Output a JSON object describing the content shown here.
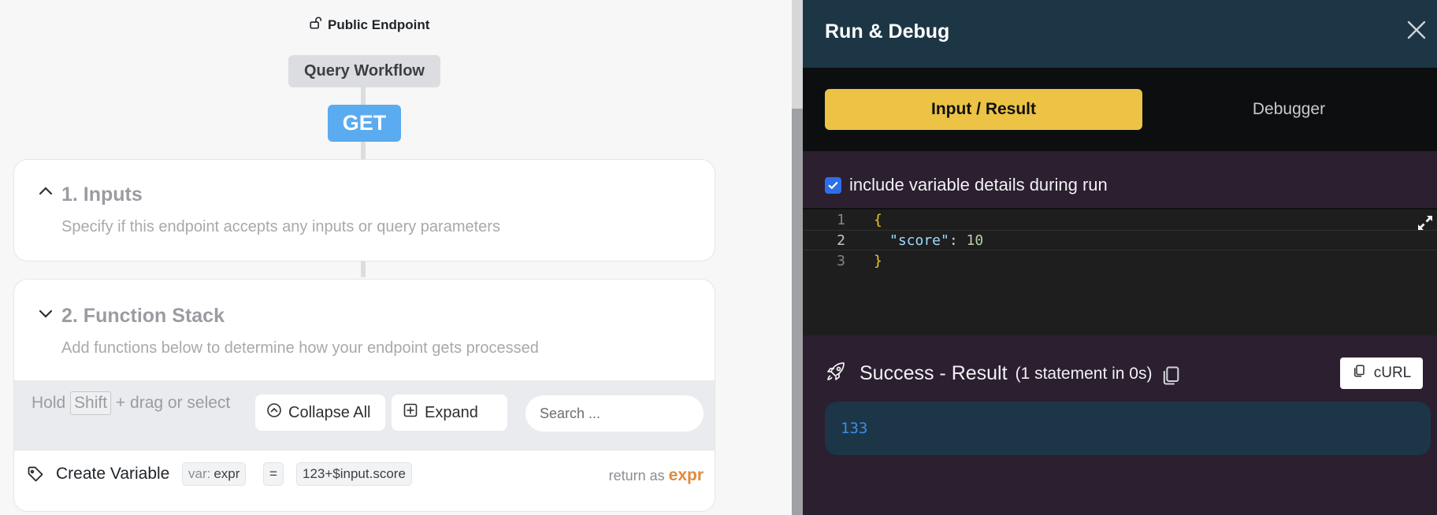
{
  "canvas": {
    "endpoint_label": "Public Endpoint",
    "workflow_name": "Query Workflow",
    "method": "GET",
    "inputs": {
      "title": "1. Inputs",
      "subtitle": "Specify if this endpoint accepts any inputs or query parameters"
    },
    "function_stack": {
      "title": "2. Function Stack",
      "subtitle": "Add functions below to determine how your endpoint gets processed",
      "hint_prefix": "Hold",
      "hint_key": "Shift",
      "hint_suffix": "+ drag or select",
      "collapse_label": "Collapse All",
      "expand_label": "Expand",
      "search_placeholder": "Search ...",
      "row": {
        "name": "Create Variable",
        "var_prefix": "var:",
        "var_name": "expr",
        "operator": "=",
        "expression": "123+$input.score",
        "return_prefix": "return as",
        "return_name": "expr"
      }
    }
  },
  "panel": {
    "title": "Run & Debug",
    "tabs": [
      "Input / Result",
      "Debugger"
    ],
    "include_details_label": "include variable details during run",
    "include_details_checked": true,
    "editor": {
      "lines": [
        "1",
        "2",
        "3"
      ],
      "open_brace": "{",
      "key": "\"score\"",
      "colon": ":",
      "value": "10",
      "close_brace": "}"
    },
    "result": {
      "title": "Success - Result",
      "meta": "(1 statement in 0s)",
      "curl_label": "cURL",
      "value": "133"
    }
  },
  "colors": {
    "accent_yellow": "#ecc344",
    "get_blue": "#5aabf0",
    "panel_header": "#1d3646",
    "return_orange": "#e08a3c"
  },
  "icons": [
    "lock-open-icon",
    "chevron-up-icon",
    "chevron-down-icon",
    "collapse-icon",
    "expand-icon",
    "tag-icon",
    "close-icon",
    "rocket-icon",
    "copy-icon",
    "fullscreen-icon",
    "checkmark-icon"
  ]
}
